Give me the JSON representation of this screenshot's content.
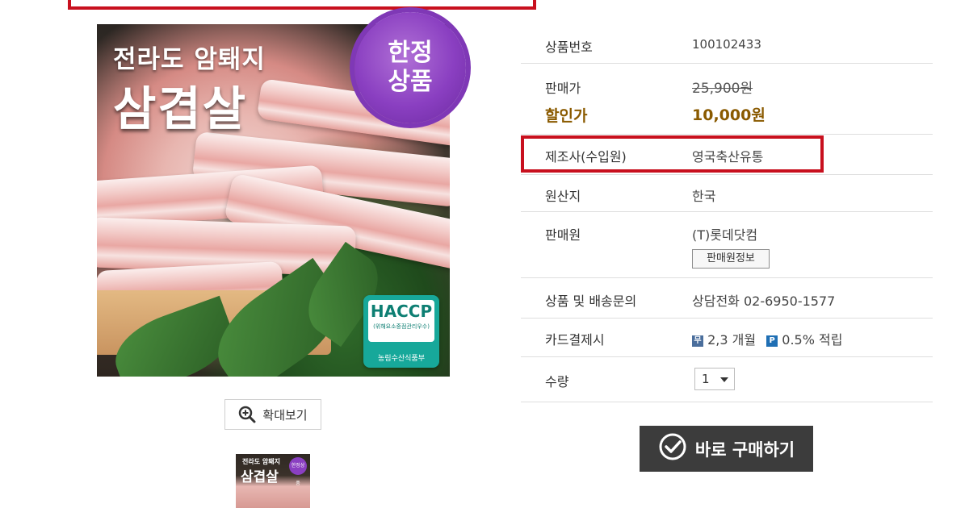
{
  "image": {
    "title_small": "전라도 암퇘지",
    "title_big": "삼겹살",
    "badge_line1": "한정",
    "badge_line2": "상품",
    "haccp_label": "HACCP",
    "haccp_sub": "(위해요소중점관리우수)",
    "haccp_bottom": "농림수산식품부"
  },
  "zoom_button": {
    "label": "확대보기",
    "icon": "zoom-in-icon"
  },
  "thumbnail": {
    "title_small": "전라도 암퇘지",
    "title_big": "삼겹살",
    "badge": "한정상품"
  },
  "info": {
    "product_no": {
      "label": "상품번호",
      "value": "100102433"
    },
    "price": {
      "label": "판매가",
      "value": "25,900원"
    },
    "discount": {
      "label": "할인가",
      "value": "10,000원"
    },
    "manufacturer": {
      "label": "제조사(수입원)",
      "value": "영국축산유통"
    },
    "origin": {
      "label": "원산지",
      "value": "한국"
    },
    "seller": {
      "label": "판매원",
      "value": "(T)롯데닷컴",
      "button": "판매원정보"
    },
    "inquiry": {
      "label": "상품 및 배송문의",
      "value": "상담전화 02-6950-1577"
    },
    "card": {
      "label": "카드결제시",
      "installment": "2,3 개월",
      "points": "0.5% 적립",
      "icon1": "무",
      "icon2": "P"
    },
    "quantity": {
      "label": "수량",
      "value": "1"
    }
  },
  "buy_button": {
    "label": "바로 구매하기",
    "icon": "check-circle-icon"
  },
  "colors": {
    "highlight": "#c8101e",
    "badge": "#8a3fc1",
    "discount": "#8a5a00",
    "buy_bg": "#3c3c3c"
  }
}
